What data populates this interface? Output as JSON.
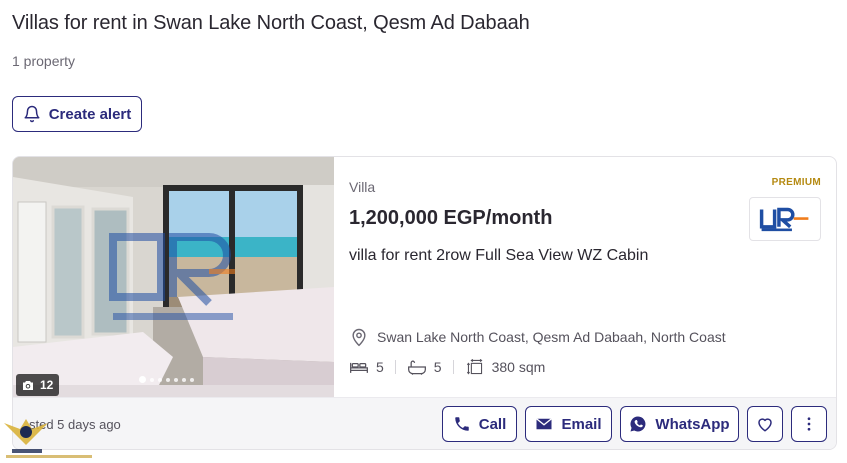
{
  "page": {
    "title": "Villas for rent in Swan Lake North Coast, Qesm Ad Dabaah",
    "count": "1 property",
    "create_alert_label": "Create alert"
  },
  "listing": {
    "photo_count": "12",
    "photo_dots": 7,
    "type": "Villa",
    "price": "1,200,000 EGP/month",
    "title": "villa for rent 2row Full Sea View WZ Cabin",
    "badge": "PREMIUM",
    "agency_logo_text": "UR",
    "location": "Swan Lake North Coast, Qesm Ad Dabaah, North Coast",
    "bedrooms": "5",
    "bathrooms": "5",
    "area": "380 sqm",
    "listed": "sted 5 days ago",
    "actions": {
      "call": "Call",
      "email": "Email",
      "whatsapp": "WhatsApp"
    }
  },
  "colors": {
    "primary": "#2c2b7c",
    "premium": "#b58a12",
    "logo_blue": "#1f4ea3",
    "logo_orange": "#f07d1c"
  },
  "icons": {
    "alert": "bell-icon",
    "camera": "camera-icon",
    "location": "location-pin-icon",
    "bed": "bed-icon",
    "bath": "bathtub-icon",
    "area": "area-icon",
    "call": "phone-icon",
    "email": "envelope-icon",
    "whatsapp": "whatsapp-icon",
    "favorite": "heart-icon",
    "more": "more-vertical-icon"
  }
}
